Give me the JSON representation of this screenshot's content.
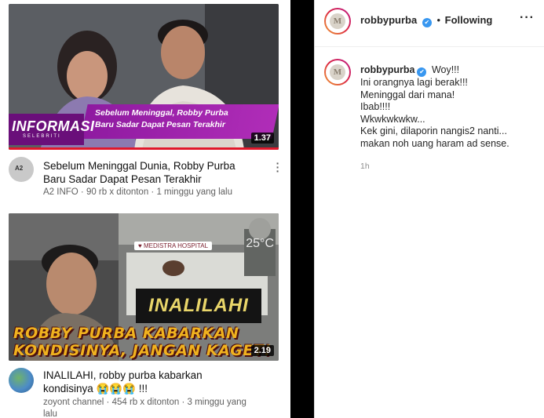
{
  "youtube": {
    "video1": {
      "thumb_banner_logo": "INFORMASI",
      "thumb_banner_logo_sub": "SELEBRITI",
      "thumb_caption_line1": "Sebelum Meninggal, Robby Purba",
      "thumb_caption_line2": "Baru Sadar Dapat Pesan Terakhir",
      "duration": "1.37",
      "channel_avatar_label": "A2",
      "title_line1": "Sebelum Meninggal Dunia, Robby Purba",
      "title_line2": "Baru Sadar Dapat Pesan Terakhir",
      "meta": "A2 INFO · 90 rb x ditonton · 1 minggu yang lalu"
    },
    "video2": {
      "hospital_tag": "♥ MEDISTRA HOSPITAL",
      "temperature": "25°C",
      "overlay_word": "INALILAHI",
      "thumb_title_line1": "ROBBY PURBA KABARKAN",
      "thumb_title_line2": "KONDISINYA, JANGAN KAGET!",
      "duration": "2.19",
      "title_line1": "INALILAHI, robby purba kabarkan",
      "title_line2": "kondisinya 😭😭😭 !!!",
      "meta_line1": "zoyont channel · 454 rb x ditonton · 3 minggu yang",
      "meta_line2": "lalu"
    },
    "more_icon": "⋮"
  },
  "instagram": {
    "header": {
      "username": "robbypurba",
      "verified_icon": "✔",
      "separator": "•",
      "follow_status": "Following",
      "more_icon": "···"
    },
    "comment": {
      "username": "robbypurba",
      "verified_icon": "✔",
      "lines": [
        "Woy!!!",
        "Ini orangnya lagi berak!!!",
        "Meninggal dari mana!",
        "Ibab!!!!",
        "Wkwkwkwkw...",
        "Kek gini, dilaporin nangis2 nanti...",
        "makan noh uang haram ad sense."
      ],
      "time": "1h"
    },
    "avatar_mark": "M"
  },
  "colors": {
    "verified_blue": "#3897f0",
    "youtube_red": "#e0182b",
    "banner_purple": "#8e1aa0",
    "thumb_title_yellow": "#f0b21f"
  }
}
